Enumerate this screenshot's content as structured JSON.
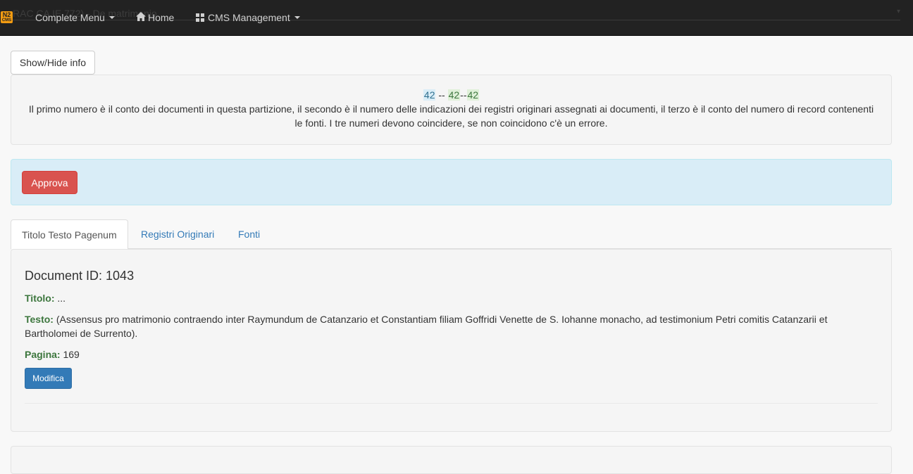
{
  "navbar": {
    "background_text": "RAC                  CA                  IE              772) - De matrimonio",
    "logo_top": "N2",
    "logo_bottom": "CMS",
    "complete_menu_label": "Complete Menu",
    "home_label": "Home",
    "cms_management_label": "CMS Management",
    "icons": {
      "home": "home-icon",
      "cms": "grid-icon",
      "dropdown": "caret-down-icon"
    }
  },
  "toggle_button": {
    "label": "Show/Hide info"
  },
  "info": {
    "count_documents": "42",
    "sep1": " -- ",
    "count_registers": "42",
    "sep2": "--",
    "count_sources": "42",
    "description": "Il primo numero è il conto dei documenti in questa partizione, il secondo è il numero delle indicazioni dei registri originari assegnati ai documenti, il terzo è il conto del numero di record contenenti le fonti. I tre numeri devono coincidere, se non coincidono c'è un errore."
  },
  "approve_button": {
    "label": "Approva"
  },
  "tabs": [
    {
      "label": "Titolo Testo Pagenum",
      "active": true
    },
    {
      "label": "Registri Originari",
      "active": false
    },
    {
      "label": "Fonti",
      "active": false
    }
  ],
  "document": {
    "heading": "Document ID: 1043",
    "titolo_label": "Titolo:",
    "titolo_value": "...",
    "testo_label": "Testo:",
    "testo_value": "(Assensus pro matrimonio contraendo inter Raymundum de Catanzario et Constantiam filiam Goffridi Venette de S. Iohanne monacho, ad testimonium Petri comitis Catanzarii et Bartholomei de Surrento).",
    "pagina_label": "Pagina:",
    "pagina_value": "169",
    "edit_button_label": "Modifica"
  },
  "colors": {
    "navbar": "#222222",
    "accent_blue": "#337ab7",
    "danger": "#d9534f",
    "alert_info_bg": "#d9edf7",
    "label_green": "#3c763d"
  }
}
